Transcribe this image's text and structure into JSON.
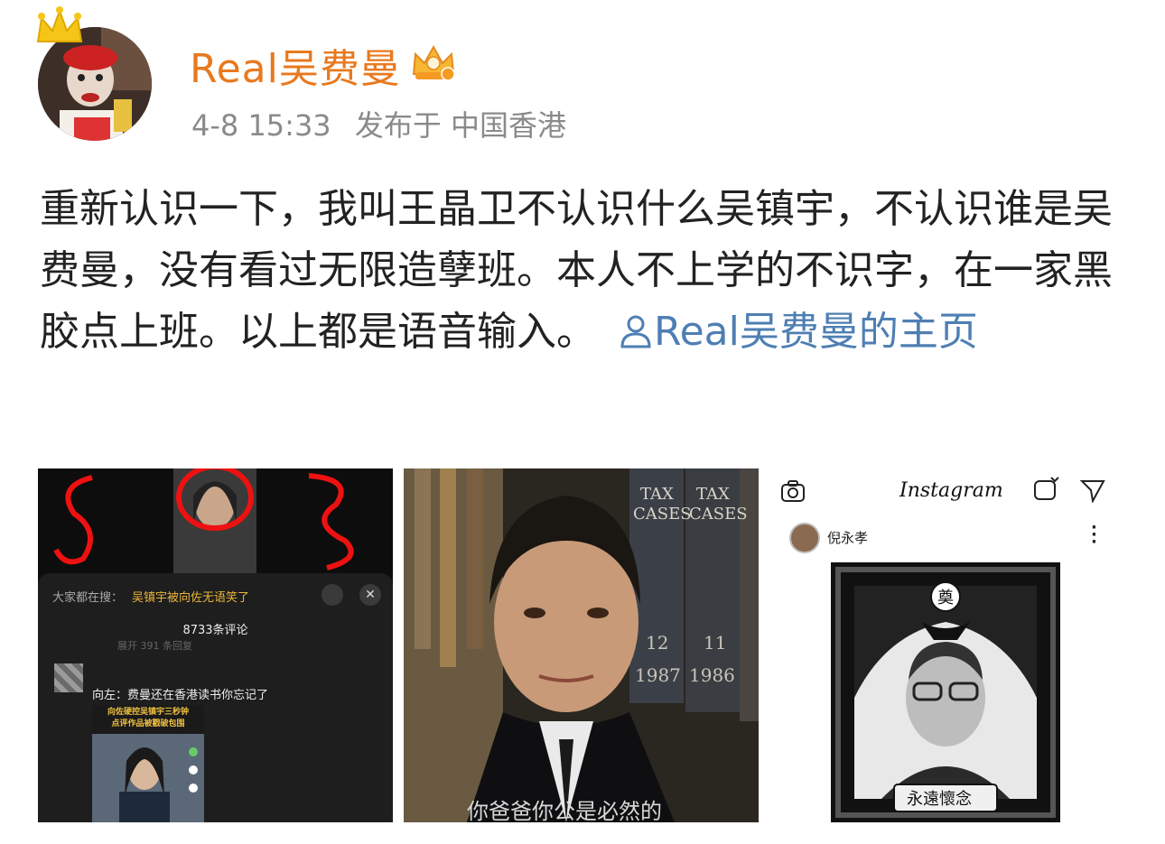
{
  "post": {
    "username": "Real吴费曼",
    "timestamp": "4-8 15:33",
    "location": "发布于 中国香港",
    "text": "重新认识一下，我叫王晶卫不认识什么吴镇宇，不认识谁是吴费曼，没有看过无限造孽班。本人不上学的不识字，在一家黑胶点上班。以上都是语音输入。",
    "profile_link": "Real吴费曼的主页"
  },
  "images": {
    "img1": {
      "search_prefix": "大家都在搜：",
      "search_query": "吴镇宇被向佐无语笑了",
      "comment_count": "8733条评论",
      "comment_text": "向左：费曼",
      "comment_suffix": "还在香港读书你忘记了",
      "video_caption_line1": "向佐硬控吴镇宇三秒钟",
      "video_caption_line2": "点评作品被戳破包围",
      "hint": "展开 391 条回复"
    },
    "img2": {
      "book_label_1": "TAX",
      "book_label_2": "CASES",
      "book_label_3": "TAX",
      "book_label_4": "CASES",
      "year_1": "1987",
      "year_2": "1986",
      "num_1": "12",
      "num_2": "11",
      "subtitle": "你爸爸你公是必然的"
    },
    "img3": {
      "app_title": "Instagram",
      "account": "倪永孝",
      "memorial_char": "奠",
      "memorial_banner": "永遠懷念"
    }
  },
  "colors": {
    "username": "#e8791e",
    "link": "#4e7fb3",
    "meta": "#8a8a8a",
    "text": "#222222"
  }
}
